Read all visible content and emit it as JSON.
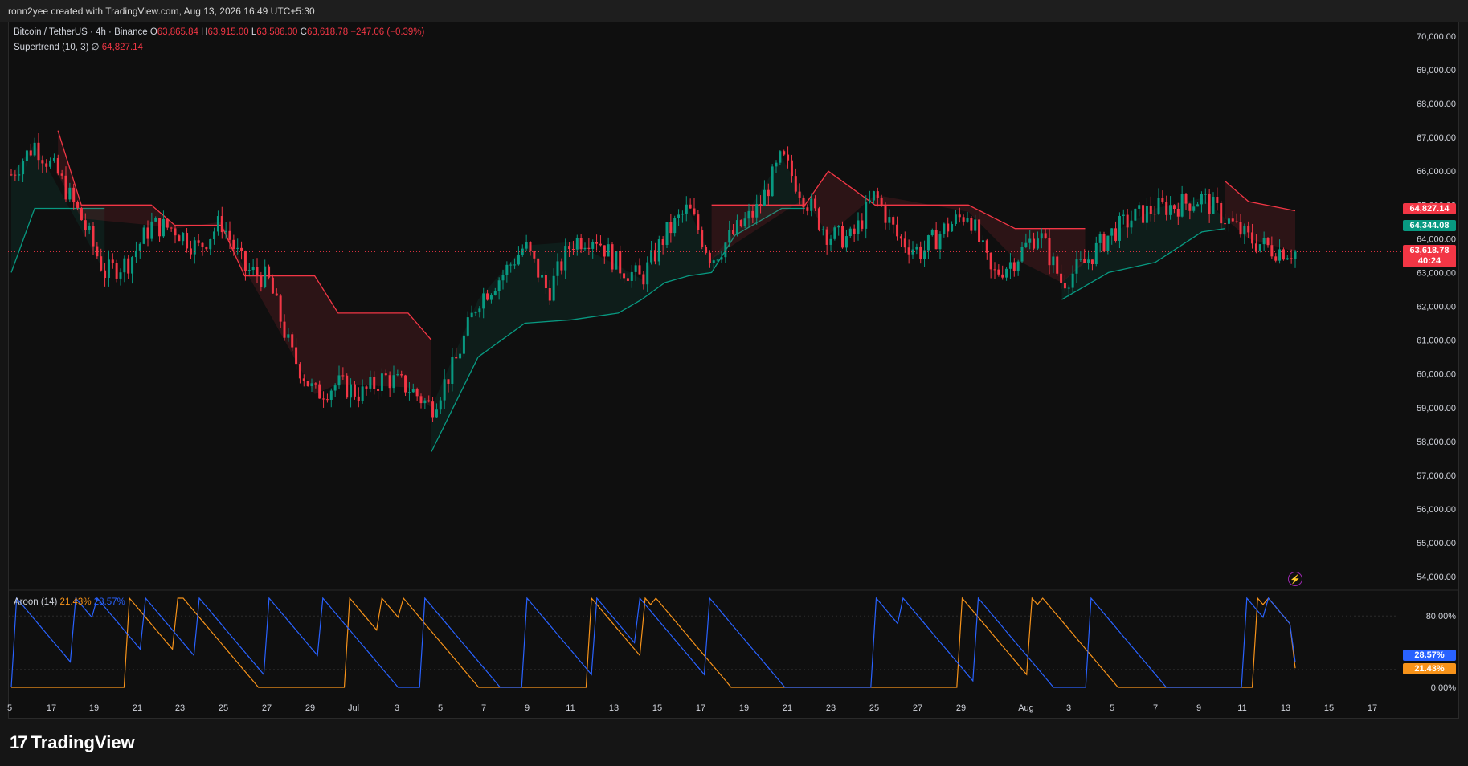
{
  "header": {
    "created_text": "ronn2yee created with TradingView.com, Aug 13, 2026 16:49 UTC+5:30"
  },
  "legend": {
    "symbol": "Bitcoin / TetherUS · 4h · Binance",
    "open_label": "O",
    "open": "63,865.84",
    "high_label": "H",
    "high": "63,915.00",
    "low_label": "L",
    "low": "63,586.00",
    "close_label": "C",
    "close": "63,618.78",
    "change": "−247.06 (−0.39%)",
    "indicator": "Supertrend (10, 3)",
    "indicator_sym": "∅",
    "indicator_value": "64,827.14"
  },
  "aroon": {
    "name": "Aroon (14)",
    "up": "21.43%",
    "down": "28.57%"
  },
  "price_tags": {
    "supertrend": "64,827.14",
    "green": "64,344.08",
    "last": "63,618.78",
    "countdown": "40:24",
    "aroon_down": "28.57%",
    "aroon_up": "21.43%"
  },
  "brand": {
    "logo": "17",
    "name": "TradingView"
  },
  "colors": {
    "bg": "#0f0f0f",
    "up": "#089981",
    "down": "#f23645",
    "aroon_up": "#f7931a",
    "aroon_down": "#2962ff"
  },
  "chart_data": [
    {
      "type": "candlestick",
      "title": "Bitcoin / TetherUS · 4h · Binance",
      "ylim": [
        53600,
        70400
      ],
      "y_ticks": [
        "70,000.00",
        "69,000.00",
        "68,000.00",
        "67,000.00",
        "66,000.00",
        "65,000.00",
        "64,000.00",
        "63,000.00",
        "62,000.00",
        "61,000.00",
        "60,000.00",
        "59,000.00",
        "58,000.00",
        "57,000.00",
        "56,000.00",
        "55,000.00",
        "54,000.00"
      ],
      "x_ticks": [
        "5",
        "17",
        "19",
        "21",
        "23",
        "25",
        "27",
        "29",
        "Jul",
        "3",
        "5",
        "7",
        "9",
        "11",
        "13",
        "15",
        "17",
        "19",
        "21",
        "23",
        "25",
        "27",
        "29",
        "Aug",
        "3",
        "5",
        "7",
        "9",
        "11",
        "13",
        "15",
        "17"
      ],
      "close_path": [
        [
          0,
          65900
        ],
        [
          1,
          66800
        ],
        [
          2,
          65900
        ],
        [
          3,
          64600
        ],
        [
          4,
          63000
        ],
        [
          5,
          63300
        ],
        [
          6,
          64400
        ],
        [
          7,
          64300
        ],
        [
          8,
          63700
        ],
        [
          9,
          64500
        ],
        [
          10,
          63100
        ],
        [
          11,
          62800
        ],
        [
          12,
          60600
        ],
        [
          13,
          59400
        ],
        [
          14,
          59700
        ],
        [
          15,
          59400
        ],
        [
          16,
          59900
        ],
        [
          17,
          59600
        ],
        [
          18,
          59000
        ],
        [
          19,
          60300
        ],
        [
          20,
          62200
        ],
        [
          21,
          62900
        ],
        [
          22,
          63800
        ],
        [
          23,
          62400
        ],
        [
          24,
          63900
        ],
        [
          25,
          64100
        ],
        [
          26,
          63200
        ],
        [
          27,
          62800
        ],
        [
          28,
          64100
        ],
        [
          29,
          64900
        ],
        [
          30,
          63400
        ],
        [
          31,
          64200
        ],
        [
          32,
          64900
        ],
        [
          33,
          66400
        ],
        [
          34,
          65200
        ],
        [
          35,
          64100
        ],
        [
          36,
          64000
        ],
        [
          37,
          65300
        ],
        [
          38,
          64000
        ],
        [
          39,
          63600
        ],
        [
          40,
          64300
        ],
        [
          41,
          64800
        ],
        [
          42,
          62900
        ],
        [
          43,
          63400
        ],
        [
          44,
          64200
        ],
        [
          45,
          62700
        ],
        [
          46,
          63300
        ],
        [
          47,
          64100
        ],
        [
          48,
          64600
        ],
        [
          49,
          64900
        ],
        [
          50,
          65000
        ],
        [
          51,
          65200
        ],
        [
          52,
          64600
        ],
        [
          53,
          64000
        ],
        [
          54,
          63700
        ],
        [
          55,
          63618
        ]
      ],
      "supertrend_lines": {
        "up": [
          [
            0,
            63000
          ],
          [
            1,
            64900
          ],
          [
            4,
            64900
          ]
        ],
        "down": [
          [
            2,
            67200
          ],
          [
            3,
            65000
          ],
          [
            6,
            65000
          ],
          [
            7,
            64400
          ],
          [
            9,
            64400
          ],
          [
            10,
            62900
          ],
          [
            13,
            62900
          ],
          [
            14,
            61800
          ],
          [
            17,
            61800
          ],
          [
            18,
            61000
          ]
        ],
        "up2": [
          [
            18,
            57700
          ],
          [
            20,
            60500
          ],
          [
            22,
            61500
          ],
          [
            24,
            61600
          ],
          [
            26,
            61800
          ],
          [
            27,
            62200
          ],
          [
            28,
            62700
          ],
          [
            29,
            62900
          ],
          [
            30,
            63000
          ],
          [
            31,
            64100
          ],
          [
            33,
            64900
          ],
          [
            34,
            64900
          ]
        ],
        "down2": [
          [
            30,
            65000
          ],
          [
            34,
            65000
          ],
          [
            35,
            66000
          ],
          [
            37,
            65000
          ],
          [
            41,
            65000
          ],
          [
            43,
            64300
          ],
          [
            45,
            64300
          ],
          [
            46,
            64300
          ]
        ],
        "up3": [
          [
            45,
            62200
          ],
          [
            47,
            63000
          ],
          [
            49,
            63300
          ],
          [
            51,
            64200
          ],
          [
            52,
            64300
          ]
        ],
        "down3": [
          [
            52,
            65700
          ],
          [
            53,
            65100
          ],
          [
            55,
            64827
          ]
        ]
      },
      "supertrend_value": 64827.14,
      "last_price": 63618.78
    },
    {
      "type": "line",
      "title": "Aroon (14)",
      "ylim": [
        0,
        100
      ],
      "y_ticks": [
        "80.00%",
        "0.00%"
      ],
      "series": [
        {
          "name": "Aroon Up",
          "color": "#f7931a",
          "last": 21.43
        },
        {
          "name": "Aroon Down",
          "color": "#2962ff",
          "last": 28.57
        }
      ]
    }
  ]
}
